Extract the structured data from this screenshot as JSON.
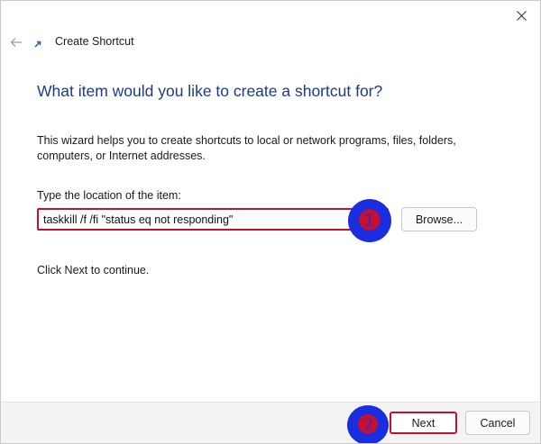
{
  "window": {
    "title": "Create Shortcut"
  },
  "icons": {
    "close": "close-icon",
    "back": "back-arrow-icon",
    "shortcut": "shortcut-arrow-icon"
  },
  "wizard": {
    "heading": "What item would you like to create a shortcut for?",
    "description": "This wizard helps you to create shortcuts to local or network programs, files, folders, computers, or Internet addresses.",
    "location_label": "Type the location of the item:",
    "location_value": "taskkill /f /fi \"status eq not responding\"",
    "browse_label": "Browse...",
    "continue_text": "Click Next to continue."
  },
  "footer": {
    "next_label": "Next",
    "cancel_label": "Cancel"
  },
  "annotations": {
    "marker_1": "❶",
    "marker_2": "❷"
  },
  "colors": {
    "heading": "#1b3a8a",
    "highlight_border": "#c8102e",
    "marker_fill": "#1a2ee0",
    "marker_digit": "#c8102e",
    "footer_bg": "#f3f3f3"
  }
}
